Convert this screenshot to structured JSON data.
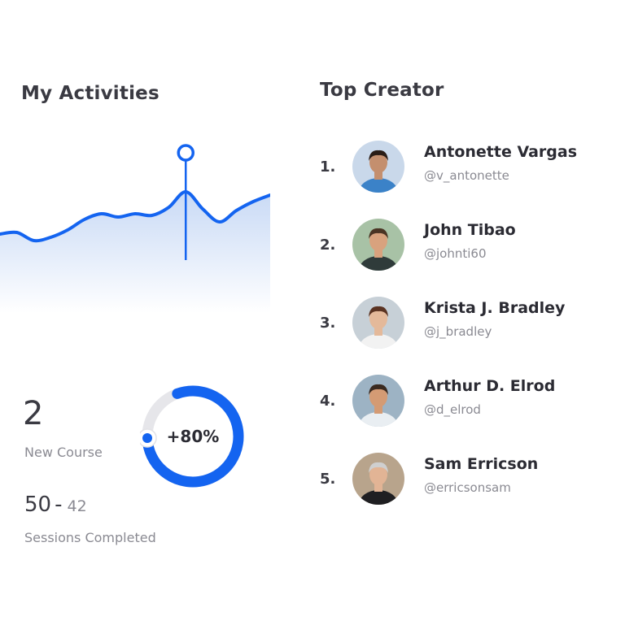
{
  "activities": {
    "title": "My Activities",
    "chart_data": {
      "type": "area",
      "values": [
        32,
        34,
        24,
        28,
        37,
        50,
        57,
        53,
        57,
        55,
        65,
        84,
        63,
        47,
        61,
        72,
        80
      ],
      "highlight_index": 11,
      "accent_color": "#1464f0"
    }
  },
  "stats": {
    "course_count": "2",
    "course_label": "New Course",
    "sessions_total": "50",
    "sessions_separator": "-",
    "sessions_done": "42",
    "sessions_label": "Sessions Completed",
    "progress_text": "+80%",
    "progress_fraction": 0.8
  },
  "top_creator": {
    "title": "Top Creator",
    "creators": [
      {
        "rank": "1.",
        "name": "Antonette Vargas",
        "handle": "@v_antonette",
        "bg": "#c9d8ea",
        "skin": "#c48f6e",
        "hair": "#2a1d16",
        "shirt": "#3b82c8"
      },
      {
        "rank": "2.",
        "name": "John Tibao",
        "handle": "@johnti60",
        "bg": "#a8c2a6",
        "skin": "#d8a27e",
        "hair": "#4a3424",
        "shirt": "#2f3b3a"
      },
      {
        "rank": "3.",
        "name": "Krista J. Bradley",
        "handle": "@j_bradley",
        "bg": "#c7d0d7",
        "skin": "#e4b99a",
        "hair": "#5a3322",
        "shirt": "#f2f2f2"
      },
      {
        "rank": "4.",
        "name": "Arthur D. Elrod",
        "handle": "@d_elrod",
        "bg": "#9db3c4",
        "skin": "#d49b74",
        "hair": "#3a2a20",
        "shirt": "#e9eef2"
      },
      {
        "rank": "5.",
        "name": "Sam Erricson",
        "handle": "@erricsonsam",
        "bg": "#b8a48c",
        "skin": "#e2b495",
        "hair": "#cfcfcf",
        "shirt": "#1f1f22"
      }
    ]
  }
}
